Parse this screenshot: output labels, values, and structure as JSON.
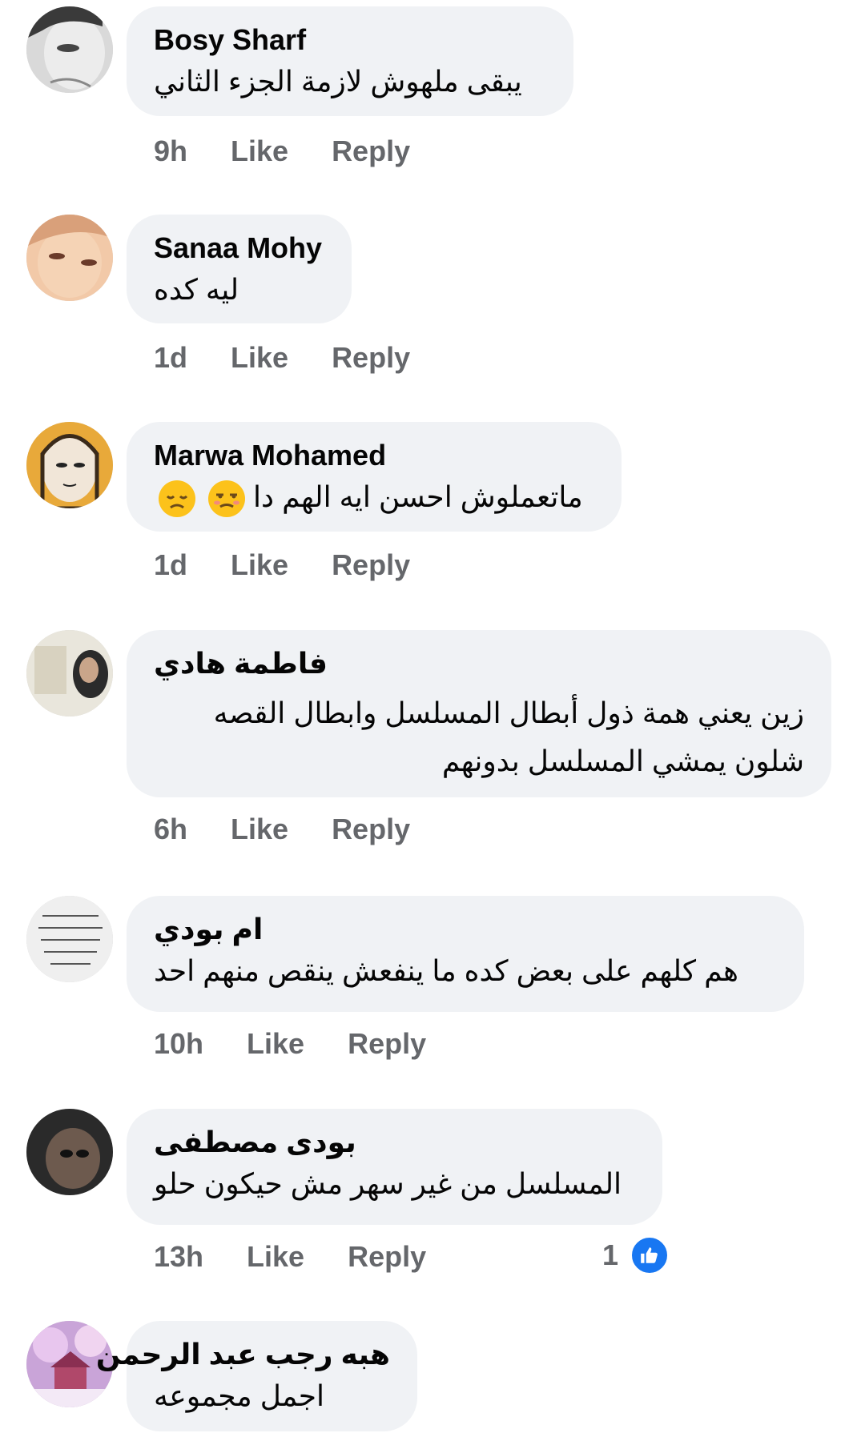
{
  "colors": {
    "bubble": "#f0f2f5",
    "meta": "#65676b",
    "like_blue": "#1877f2",
    "emoji_yellow": "#fcc21b"
  },
  "comments": [
    {
      "author": "Bosy Sharf",
      "text": [
        "يبقى ملهوش لازمة الجزء الثاني"
      ],
      "time": "9h",
      "like": "Like",
      "reply": "Reply"
    },
    {
      "author": "Sanaa Mohy",
      "text": [
        "ليه كده"
      ],
      "time": "1d",
      "like": "Like",
      "reply": "Reply"
    },
    {
      "author": "Marwa Mohamed",
      "text": [
        "ماتعملوش احسن ايه الهم دا"
      ],
      "emojis": [
        "unamused-face-icon",
        "disappointed-face-icon"
      ],
      "time": "1d",
      "like": "Like",
      "reply": "Reply"
    },
    {
      "author": "فاطمة هادي",
      "text": [
        "زين يعني همة ذول أبطال المسلسل وابطال القصه",
        "شلون يمشي المسلسل بدونهم"
      ],
      "time": "6h",
      "like": "Like",
      "reply": "Reply"
    },
    {
      "author": "ام بودي",
      "text": [
        "هم كلهم على بعض كده ما ينفعش ينقص منهم احد"
      ],
      "time": "10h",
      "like": "Like",
      "reply": "Reply"
    },
    {
      "author": "بودى مصطفى",
      "text": [
        "المسلسل من غير سهر مش حيكون حلو"
      ],
      "time": "13h",
      "like": "Like",
      "reply": "Reply",
      "reaction_count": "1",
      "reaction_icon": "thumbs-up-icon"
    },
    {
      "author": "هبه رجب عبد الرحمن",
      "text": [
        "اجمل مجموعه"
      ]
    }
  ]
}
